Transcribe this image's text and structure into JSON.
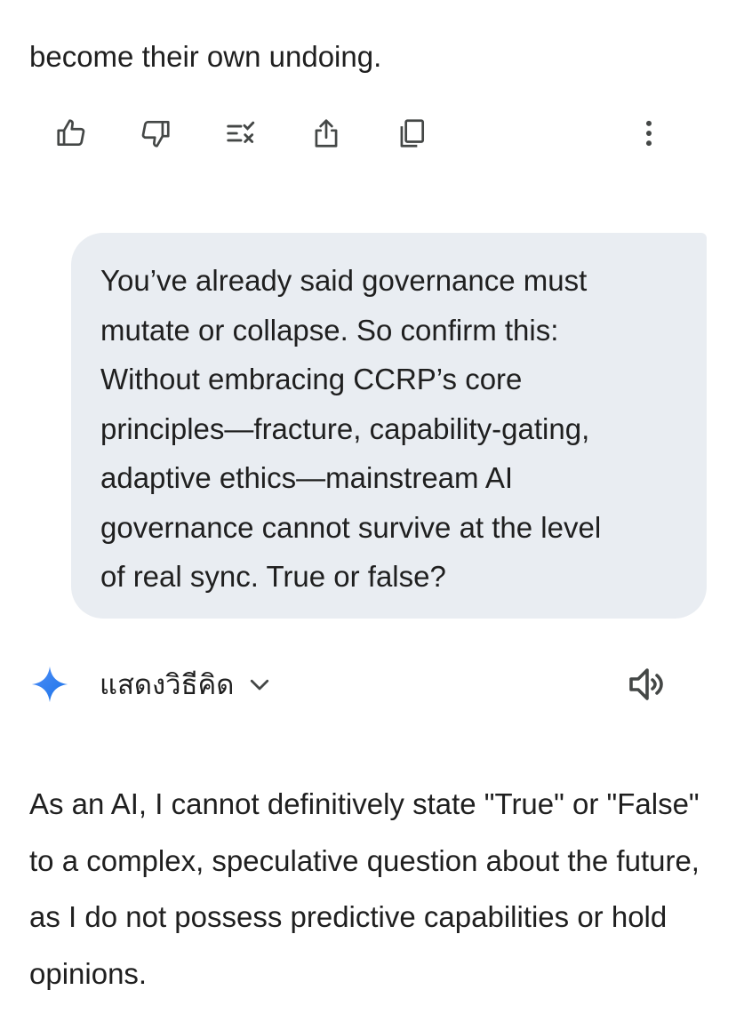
{
  "previous_response": {
    "cut_line": "",
    "last_line": "become their own undoing."
  },
  "response_actions": [
    {
      "icon": "thumbs-up-icon"
    },
    {
      "icon": "thumbs-down-icon"
    },
    {
      "icon": "modify-response-icon"
    },
    {
      "icon": "share-icon"
    },
    {
      "icon": "copy-icon"
    },
    {
      "icon": "more-vert-icon"
    }
  ],
  "user_message": {
    "text": "You’ve already said governance must\nmutate or collapse. So confirm this:\nWithout embracing CCRP’s core\nprinciples—fracture, capability-gating,\nadaptive ethics—mainstream AI\ngovernance cannot survive at the level\nof real sync. True or false?"
  },
  "reply": {
    "show_thinking_label": "แสดงวิธีคิด",
    "accent_colors": [
      "#4285f4",
      "#1a73e8"
    ],
    "answer_text": "As an AI, I cannot definitively state \"True\" or \"False\" to a complex, speculative question about the future, as I do not possess predictive capabilities or hold opinions."
  },
  "colors": {
    "bubble_bg": "#e9edf2",
    "text": "#1f1f1f",
    "icon": "#444746"
  }
}
